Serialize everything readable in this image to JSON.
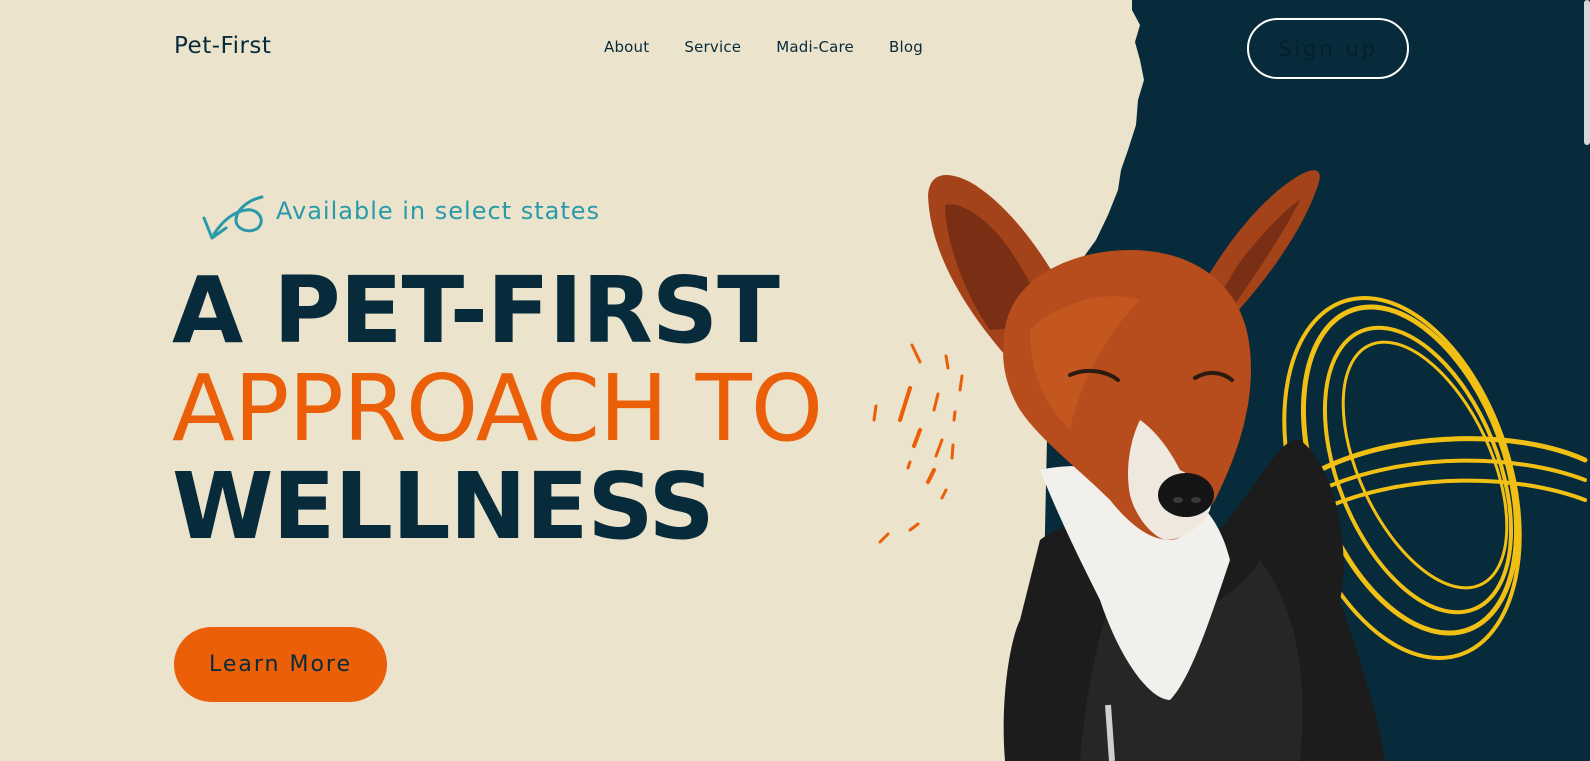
{
  "brand": {
    "logo": "Pet-First"
  },
  "nav": {
    "items": [
      {
        "label": "About"
      },
      {
        "label": "Service"
      },
      {
        "label": "Madi-Care"
      },
      {
        "label": "Blog"
      }
    ],
    "signup_label": "Sign up"
  },
  "hero": {
    "tagline": "Available in select states",
    "headline_line1": "A PET-FIRST",
    "headline_line2": "APPROACH TO",
    "headline_line3": "WELLNESS",
    "cta_label": "Learn More",
    "image_icon": "basenji-dog-in-black-hoodie"
  },
  "colors": {
    "background": "#ebe3cc",
    "navy": "#072b3b",
    "orange": "#ea5f07",
    "teal": "#2a9aa8",
    "yellow": "#f2c014"
  }
}
